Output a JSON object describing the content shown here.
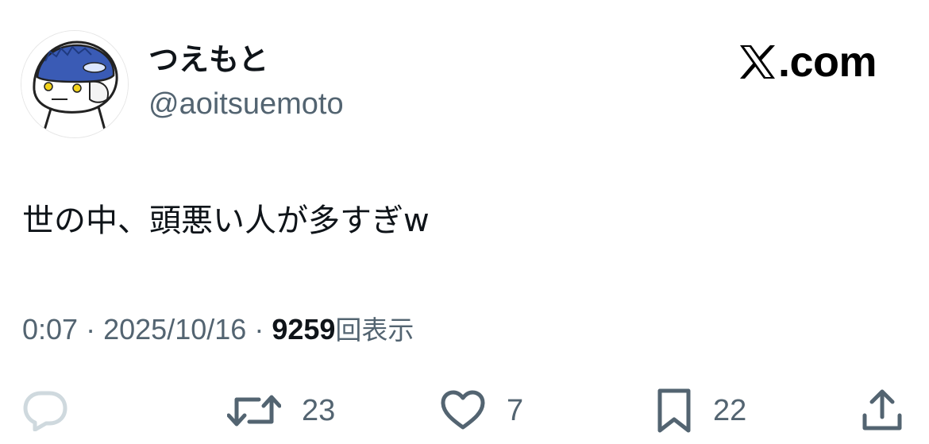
{
  "user": {
    "display_name": "つえもと",
    "handle": "@aoitsuemoto",
    "avatar_icon": "cartoon-avatar-icon"
  },
  "brand": {
    "text": ".com",
    "logo_icon": "x-logo-icon"
  },
  "tweet": {
    "text": "世の中、頭悪い人が多すぎw"
  },
  "meta": {
    "time": "0:07",
    "separator": "·",
    "date": "2025/10/16",
    "views_count": "9259",
    "views_label": "回表示"
  },
  "actions": {
    "reply": {
      "icon": "reply-icon",
      "count": ""
    },
    "retweet": {
      "icon": "retweet-icon",
      "count": "23"
    },
    "like": {
      "icon": "heart-icon",
      "count": "7"
    },
    "bookmark": {
      "icon": "bookmark-icon",
      "count": "22"
    },
    "share": {
      "icon": "share-icon"
    }
  },
  "colors": {
    "text_primary": "#0f1419",
    "text_secondary": "#536471",
    "reply_icon_muted": "#cfd9de",
    "avatar_blue": "#3a5bb5"
  }
}
